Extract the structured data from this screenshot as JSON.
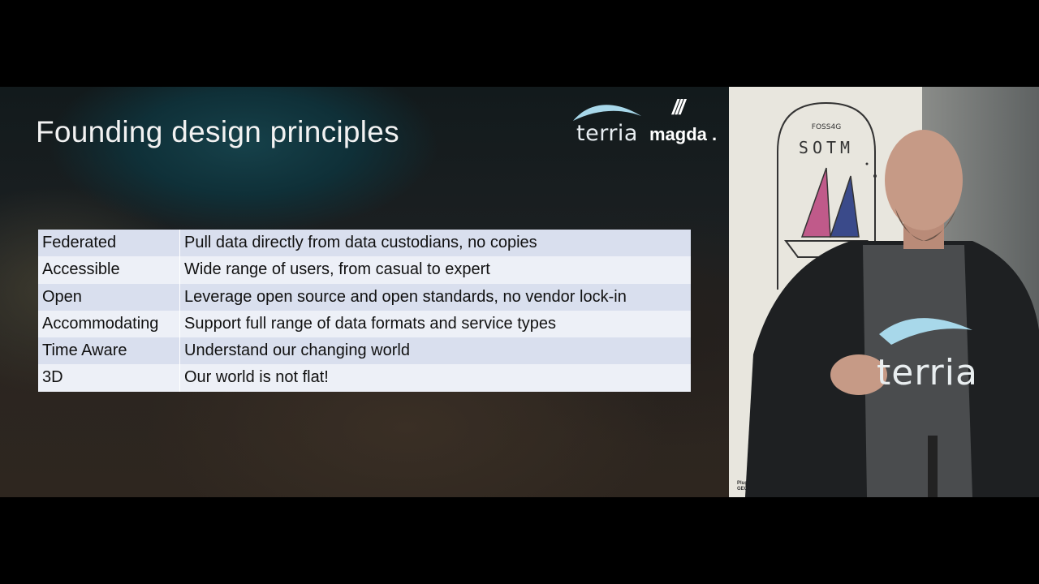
{
  "slide": {
    "title": "Founding design principles",
    "logos": {
      "terria": "terria",
      "magda": "magda",
      "magda_mark": "///"
    },
    "table": [
      {
        "term": "Federated",
        "description": "Pull data directly from data custodians, no copies"
      },
      {
        "term": "Accessible",
        "description": "Wide range of users, from casual to expert"
      },
      {
        "term": "Open",
        "description": "Leverage open source and open standards, no vendor lock-in"
      },
      {
        "term": "Accommodating",
        "description": "Support full range of data formats and service types"
      },
      {
        "term": "Time Aware",
        "description": "Understand our changing world"
      },
      {
        "term": "3D",
        "description": "Our world is not flat!"
      }
    ]
  },
  "stage": {
    "banner_text": "SOTM",
    "banner_arc": "FOSS4G",
    "shirt_text": "terria",
    "sponsor_line1": "Plugwest",
    "sponsor_line2": "GEOSPATIAL"
  },
  "colors": {
    "row_odd": "#d9dfee",
    "row_even": "#edf0f7",
    "title": "#f2f2f2",
    "terria_wave": "#a8d8ea"
  }
}
